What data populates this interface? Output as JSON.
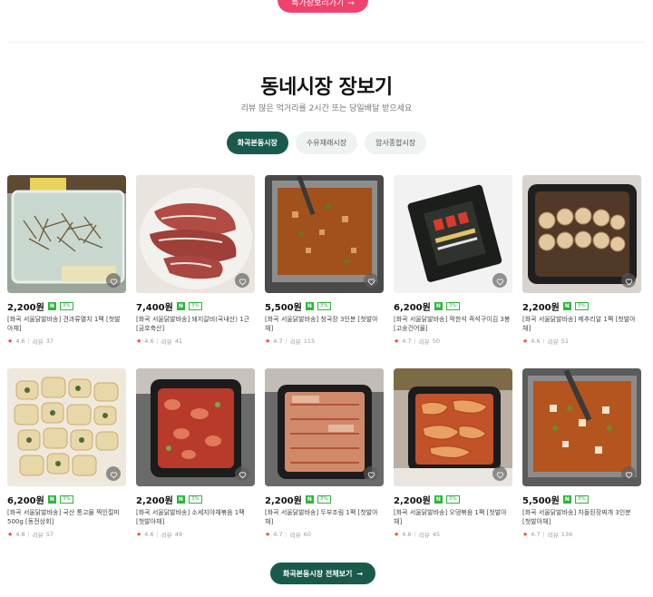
{
  "top_cta": {
    "label": "특가장보러가기",
    "arrow": "→"
  },
  "section": {
    "title": "동네시장 장보기",
    "subtitle": "리뷰 많은 먹거리를 2시간 또는 당일배달 받으세요"
  },
  "tabs": [
    {
      "label": "화곡본동시장",
      "active": true
    },
    {
      "label": "수유재래시장",
      "active": false
    },
    {
      "label": "암사종합시장",
      "active": false
    }
  ],
  "badges": {
    "n": "N",
    "pct": "3%"
  },
  "review_label": "리뷰",
  "products": [
    {
      "price": "2,200원",
      "name": "[화곡 서울닭발바송] 견과류멸치 1팩 [첫발아채]",
      "rating": "4.6",
      "reviews": "37",
      "image": "anchovy"
    },
    {
      "price": "7,400원",
      "name": "[화곡 서울닭발바송] 돼지갈비(국내산) 1근 [금호축산]",
      "rating": "4.6",
      "reviews": "41",
      "image": "pork"
    },
    {
      "price": "5,500원",
      "name": "[화곡 서울닭발바송] 청국장 3인분 [첫발아채]",
      "rating": "4.7",
      "reviews": "115",
      "image": "stew"
    },
    {
      "price": "6,200원",
      "name": "[화곡 서울닭발바송] 먹한석 즉석구이김 3봉 [고송건어물]",
      "rating": "4.7",
      "reviews": "50",
      "image": "laver"
    },
    {
      "price": "2,200원",
      "name": "[화곡 서울닭발바송] 메추리알 1팩 [첫발아채]",
      "rating": "4.6",
      "reviews": "51",
      "image": "eggs"
    },
    {
      "price": "6,200원",
      "name": "[화곡 서울닭발바송] 국산 통고물 찍인절미 500g [동전상회]",
      "rating": "4.8",
      "reviews": "57",
      "image": "ricecake"
    },
    {
      "price": "2,200원",
      "name": "[화곡 서울닭발바송] 소세지야채볶음 1팩 [첫발아채]",
      "rating": "4.6",
      "reviews": "49",
      "image": "sausage"
    },
    {
      "price": "2,200원",
      "name": "[화곡 서울닭발바송] 두부조림 1팩 [첫발아채]",
      "rating": "4.7",
      "reviews": "60",
      "image": "tofu"
    },
    {
      "price": "2,200원",
      "name": "[화곡 서울닭발바송] 오뎅볶음 1팩 [첫발아채]",
      "rating": "4.6",
      "reviews": "45",
      "image": "fishcake"
    },
    {
      "price": "5,500원",
      "name": "[화곡 서울닭발바송] 차돌된장찌개 3인분 [첫발아채]",
      "rating": "4.7",
      "reviews": "136",
      "image": "doenjang"
    }
  ],
  "bottom_cta": {
    "label": "화곡본동시장 전체보기",
    "arrow": "→"
  }
}
